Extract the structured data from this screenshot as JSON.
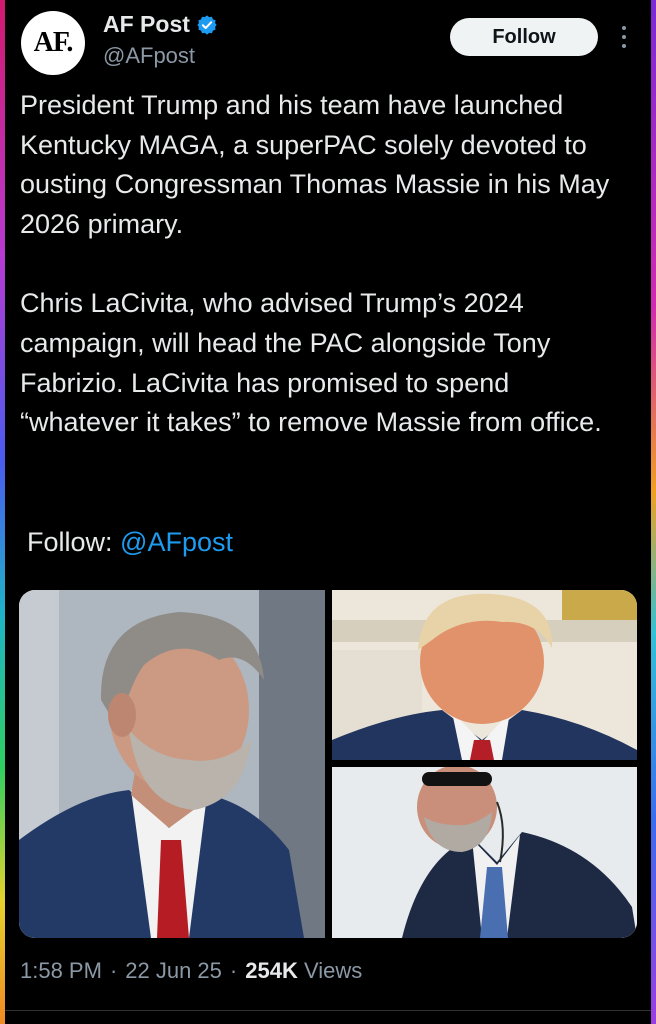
{
  "author": {
    "display_name": "AF Post",
    "handle": "@AFpost",
    "avatar_text": "AF.",
    "verified": true
  },
  "follow_button": {
    "label": "Follow"
  },
  "tweet": {
    "paragraph1": "President Trump and his team have launched Kentucky MAGA, a superPAC solely devoted to ousting Congressman Thomas Massie in his May 2026 primary.",
    "paragraph2": "Chris LaCivita, who advised Trump’s 2024 campaign, will head the PAC alongside Tony Fabrizio. LaCivita has promised to spend “whatever it takes” to remove Massie from office.",
    "follow_prefix": "Follow: ",
    "follow_mention": "@AFpost"
  },
  "meta": {
    "time": "1:58 PM",
    "separator": "·",
    "date": "22 Jun 25",
    "views_count": "254K",
    "views_label": "Views"
  },
  "colors": {
    "background": "#000000",
    "text": "#e7e9ea",
    "secondary_text": "#8b98a5",
    "link": "#1d9bf0",
    "verified_badge": "#1d9bf0"
  }
}
